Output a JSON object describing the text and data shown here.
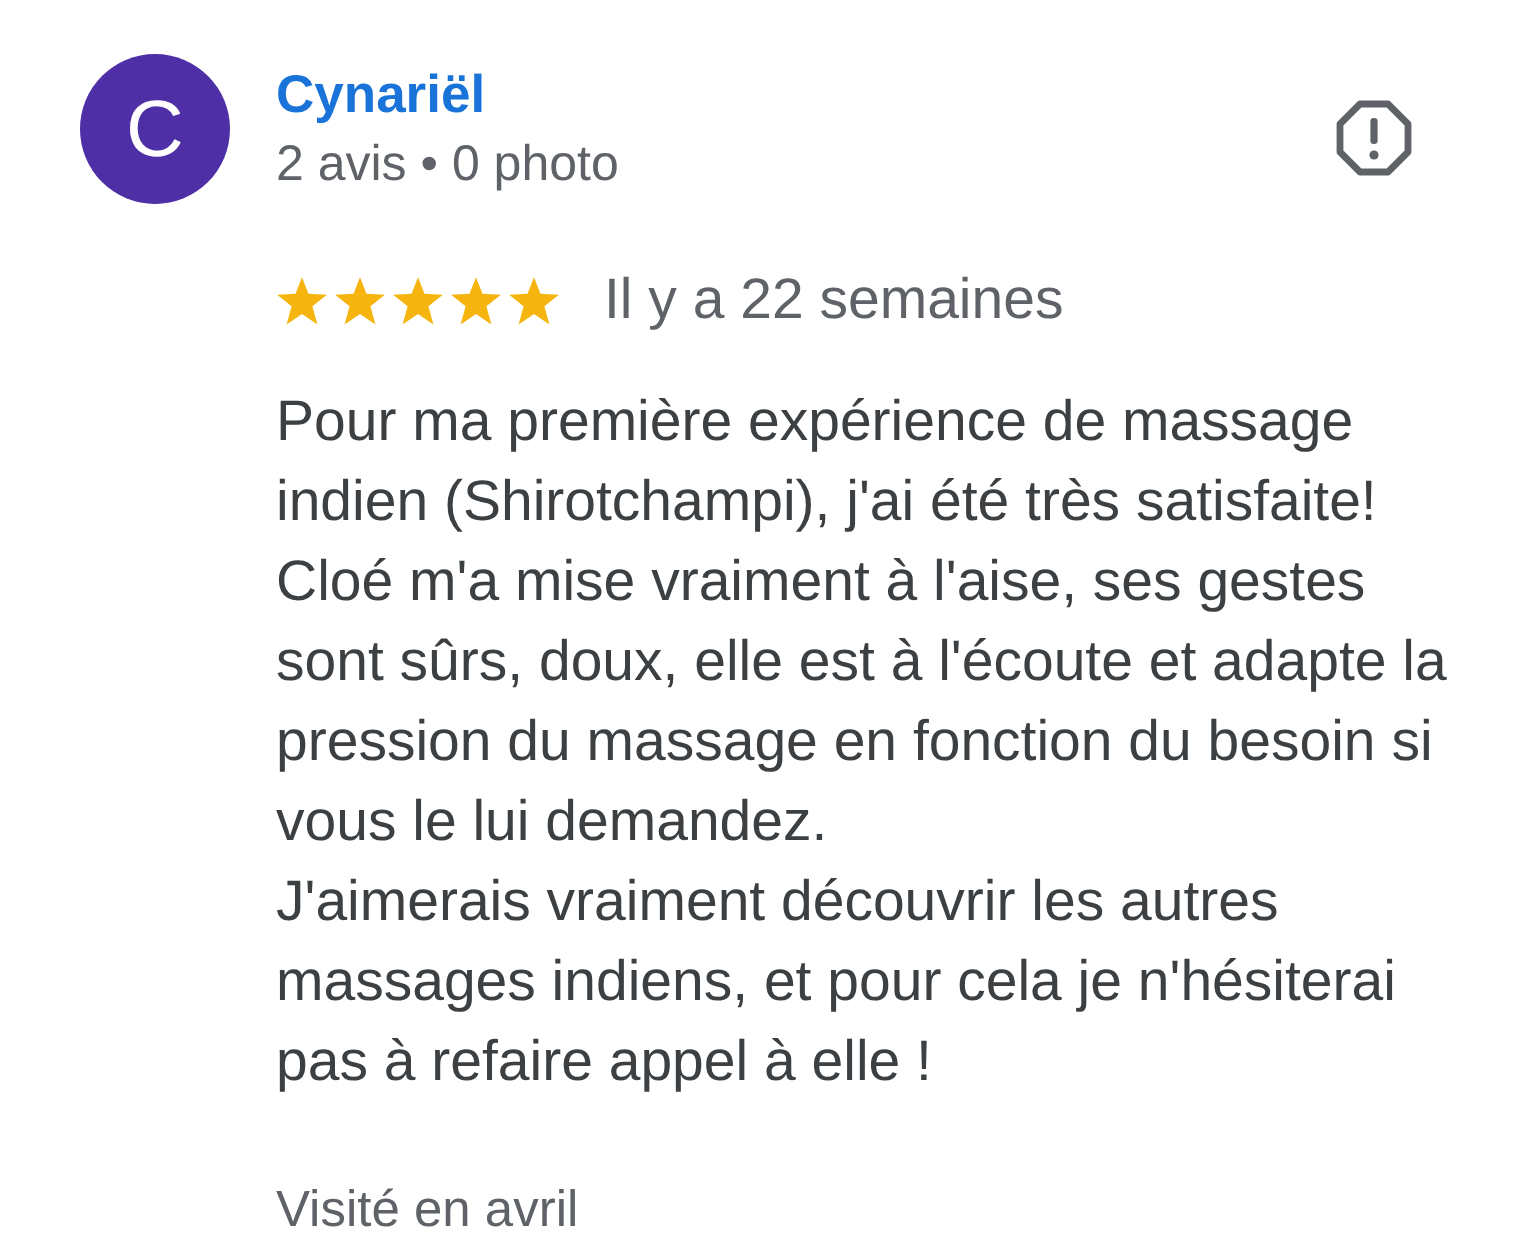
{
  "reviewer": {
    "initial": "C",
    "name": "Cynariël",
    "stats": "2 avis • 0 photo"
  },
  "review": {
    "stars": 5,
    "time": "Il y a 22 semaines",
    "text": "Pour ma première expérience de massage indien (Shirotchampi), j'ai été très satisfaite!\nCloé m'a mise vraiment à l'aise, ses gestes sont sûrs, doux, elle est à l'écoute et adapte la pression du massage en fonction du besoin si vous le lui demandez.\nJ'aimerais vraiment découvrir les autres massages indiens, et pour cela je n'hésiterai pas à refaire appel à elle !",
    "visit": "Visité en avril"
  }
}
